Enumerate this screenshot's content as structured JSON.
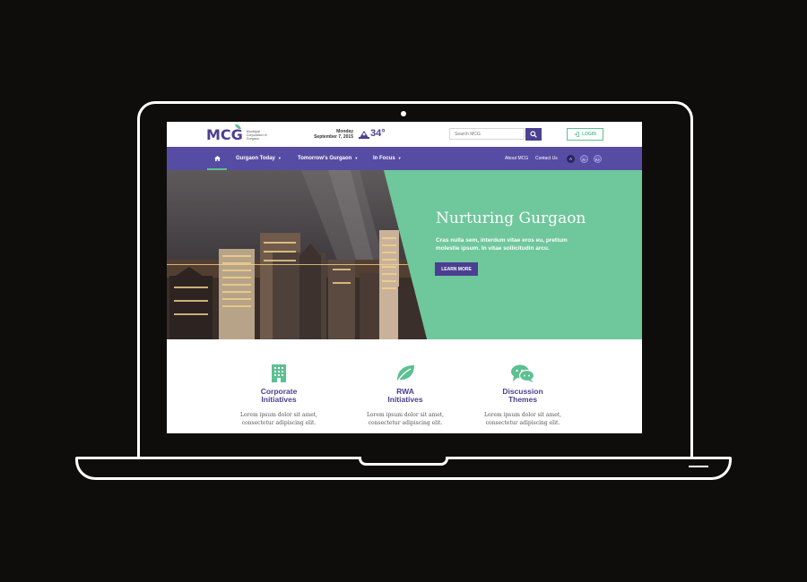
{
  "logo": {
    "mark": "MCG",
    "subtitle": "Municipal Corporation of Gurgaon"
  },
  "header": {
    "day": "Monday",
    "date": "September 7, 2015",
    "temperature": "34°",
    "search_placeholder": "Search MCG",
    "login_label": "LOGIN"
  },
  "nav": {
    "items": [
      {
        "label": "Gurgaon Today"
      },
      {
        "label": "Tomorrow's Gurgaon"
      },
      {
        "label": "In Focus"
      }
    ],
    "about": "About MCG",
    "contact": "Contact Us",
    "font_sizes": [
      "A",
      "A-",
      "A+"
    ]
  },
  "hero": {
    "title": "Nurturing Gurgaon",
    "text": "Cras nulla sem, interdum vitae eros eu, pretium molestie ipsum. In vitae sollicitudin arcu.",
    "button": "LEARN MORE"
  },
  "features": [
    {
      "title_line1": "Corporate",
      "title_line2": "Initiatives",
      "text_line1": "Lorem ipsum dolor sit amet,",
      "text_line2": "consectetur adipiscing elit.",
      "icon": "building-icon"
    },
    {
      "title_line1": "RWA",
      "title_line2": "Initiatives",
      "text_line1": "Lorem ipsum dolor sit amet,",
      "text_line2": "consectetur adipiscing elit.",
      "icon": "leaf-icon"
    },
    {
      "title_line1": "Discussion",
      "title_line2": "Themes",
      "text_line1": "Lorem ipsum dolor sit amet,",
      "text_line2": "consectetur adipiscing elit.",
      "icon": "chat-icon"
    }
  ],
  "colors": {
    "brand_purple": "#4b3f92",
    "nav_purple": "#574ca3",
    "accent_green": "#5cc091",
    "hero_green": "#6fc79c"
  }
}
